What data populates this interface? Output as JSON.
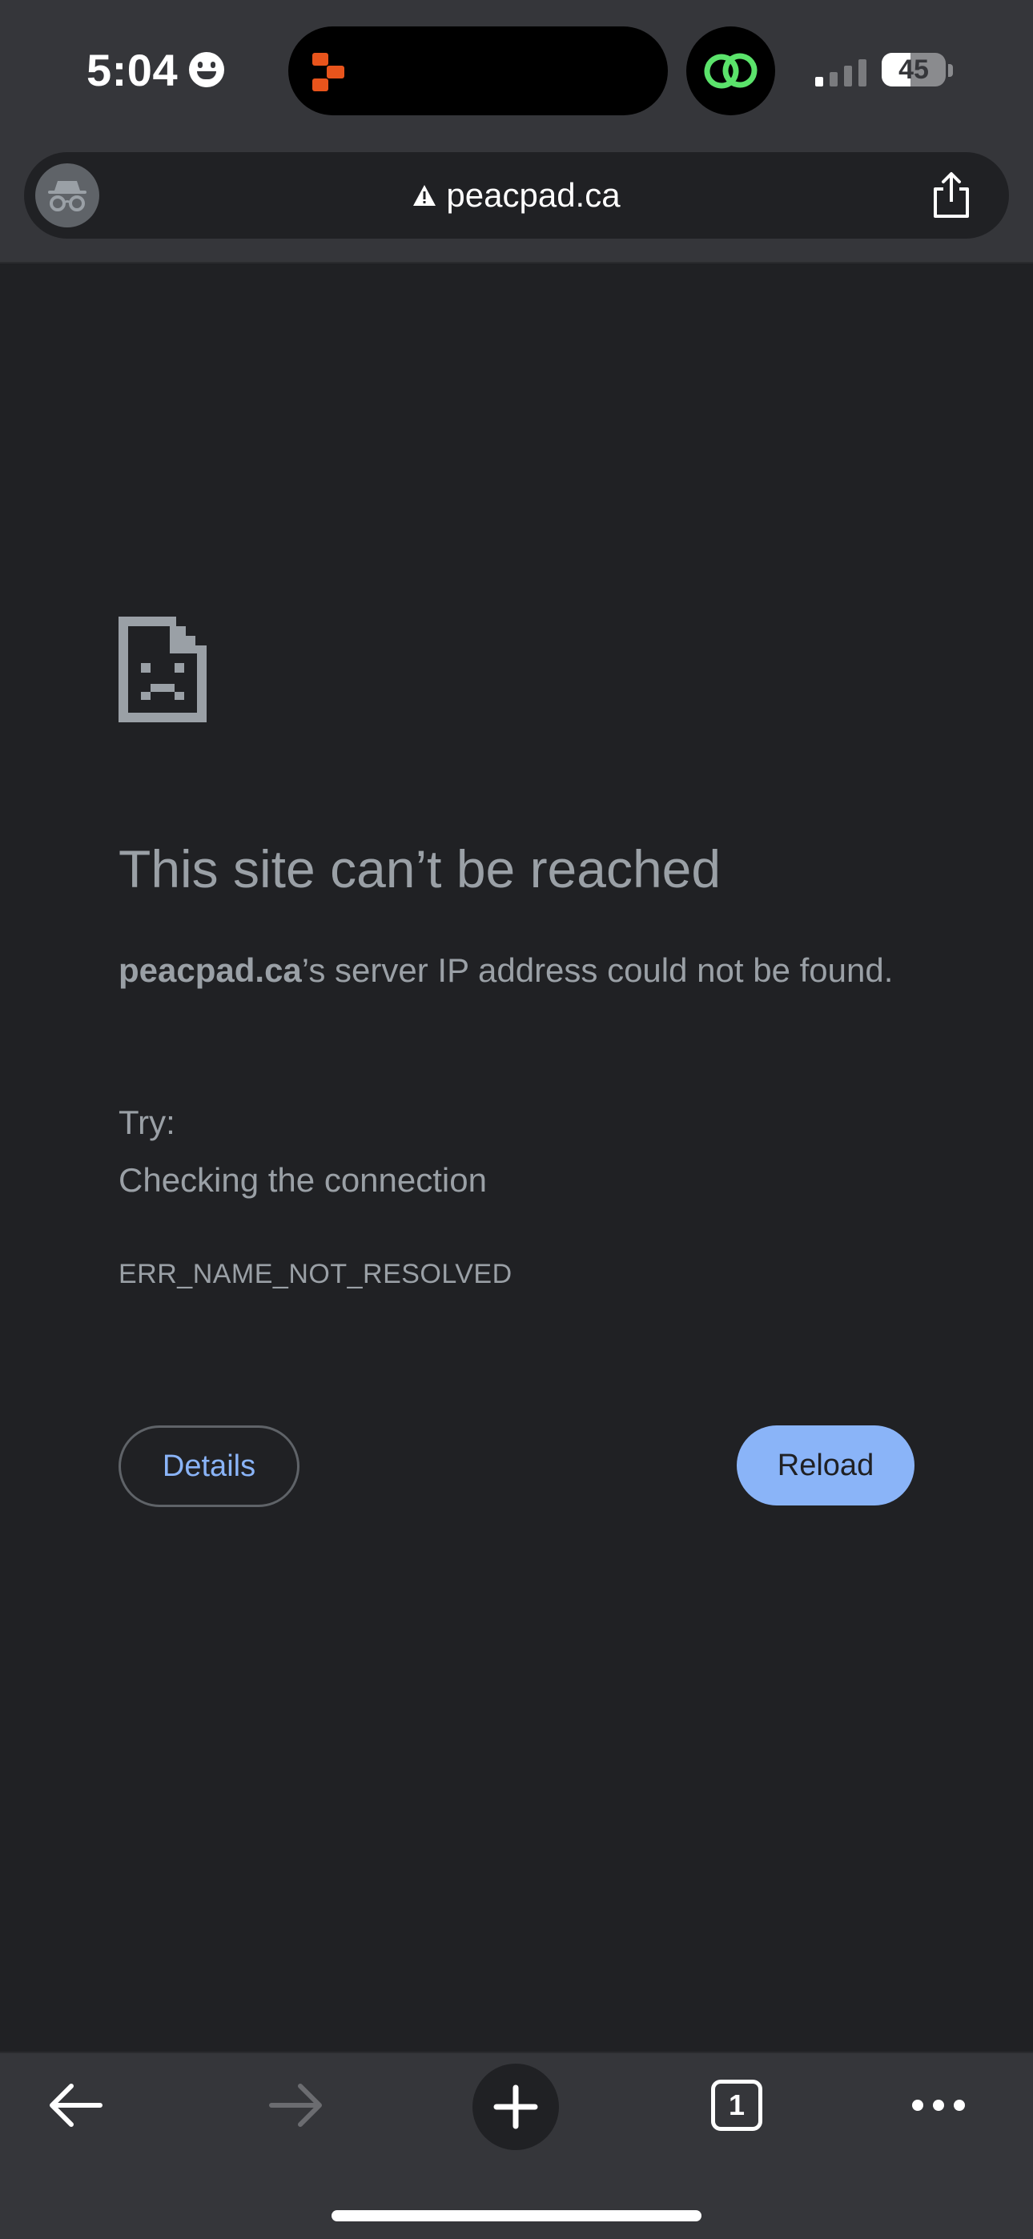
{
  "status_bar": {
    "time": "5:04",
    "battery_level": "45",
    "battery_fraction": 0.45
  },
  "url_bar": {
    "url": "peacpad.ca"
  },
  "error_page": {
    "title": "This site can’t be reached",
    "host": "peacpad.ca",
    "description_rest": "’s server IP address could not be found.",
    "try_label": "Try:",
    "suggestions": [
      "Checking the connection"
    ],
    "error_code": "ERR_NAME_NOT_RESOLVED",
    "details_label": "Details",
    "reload_label": "Reload"
  },
  "toolbar": {
    "tab_count": "1"
  },
  "colors": {
    "page_background": "#202124",
    "chrome_background": "#35363a",
    "accent_blue": "#8ab4f8",
    "text_gray": "#9aa0a6"
  },
  "icons": [
    "smiley-icon",
    "app-activity-icon",
    "link-icon",
    "signal-icon",
    "battery-icon",
    "incognito-icon",
    "warning-icon",
    "share-icon",
    "sad-document-icon",
    "back-arrow-icon",
    "forward-arrow-icon",
    "plus-icon",
    "tab-switcher-icon",
    "more-icon"
  ]
}
